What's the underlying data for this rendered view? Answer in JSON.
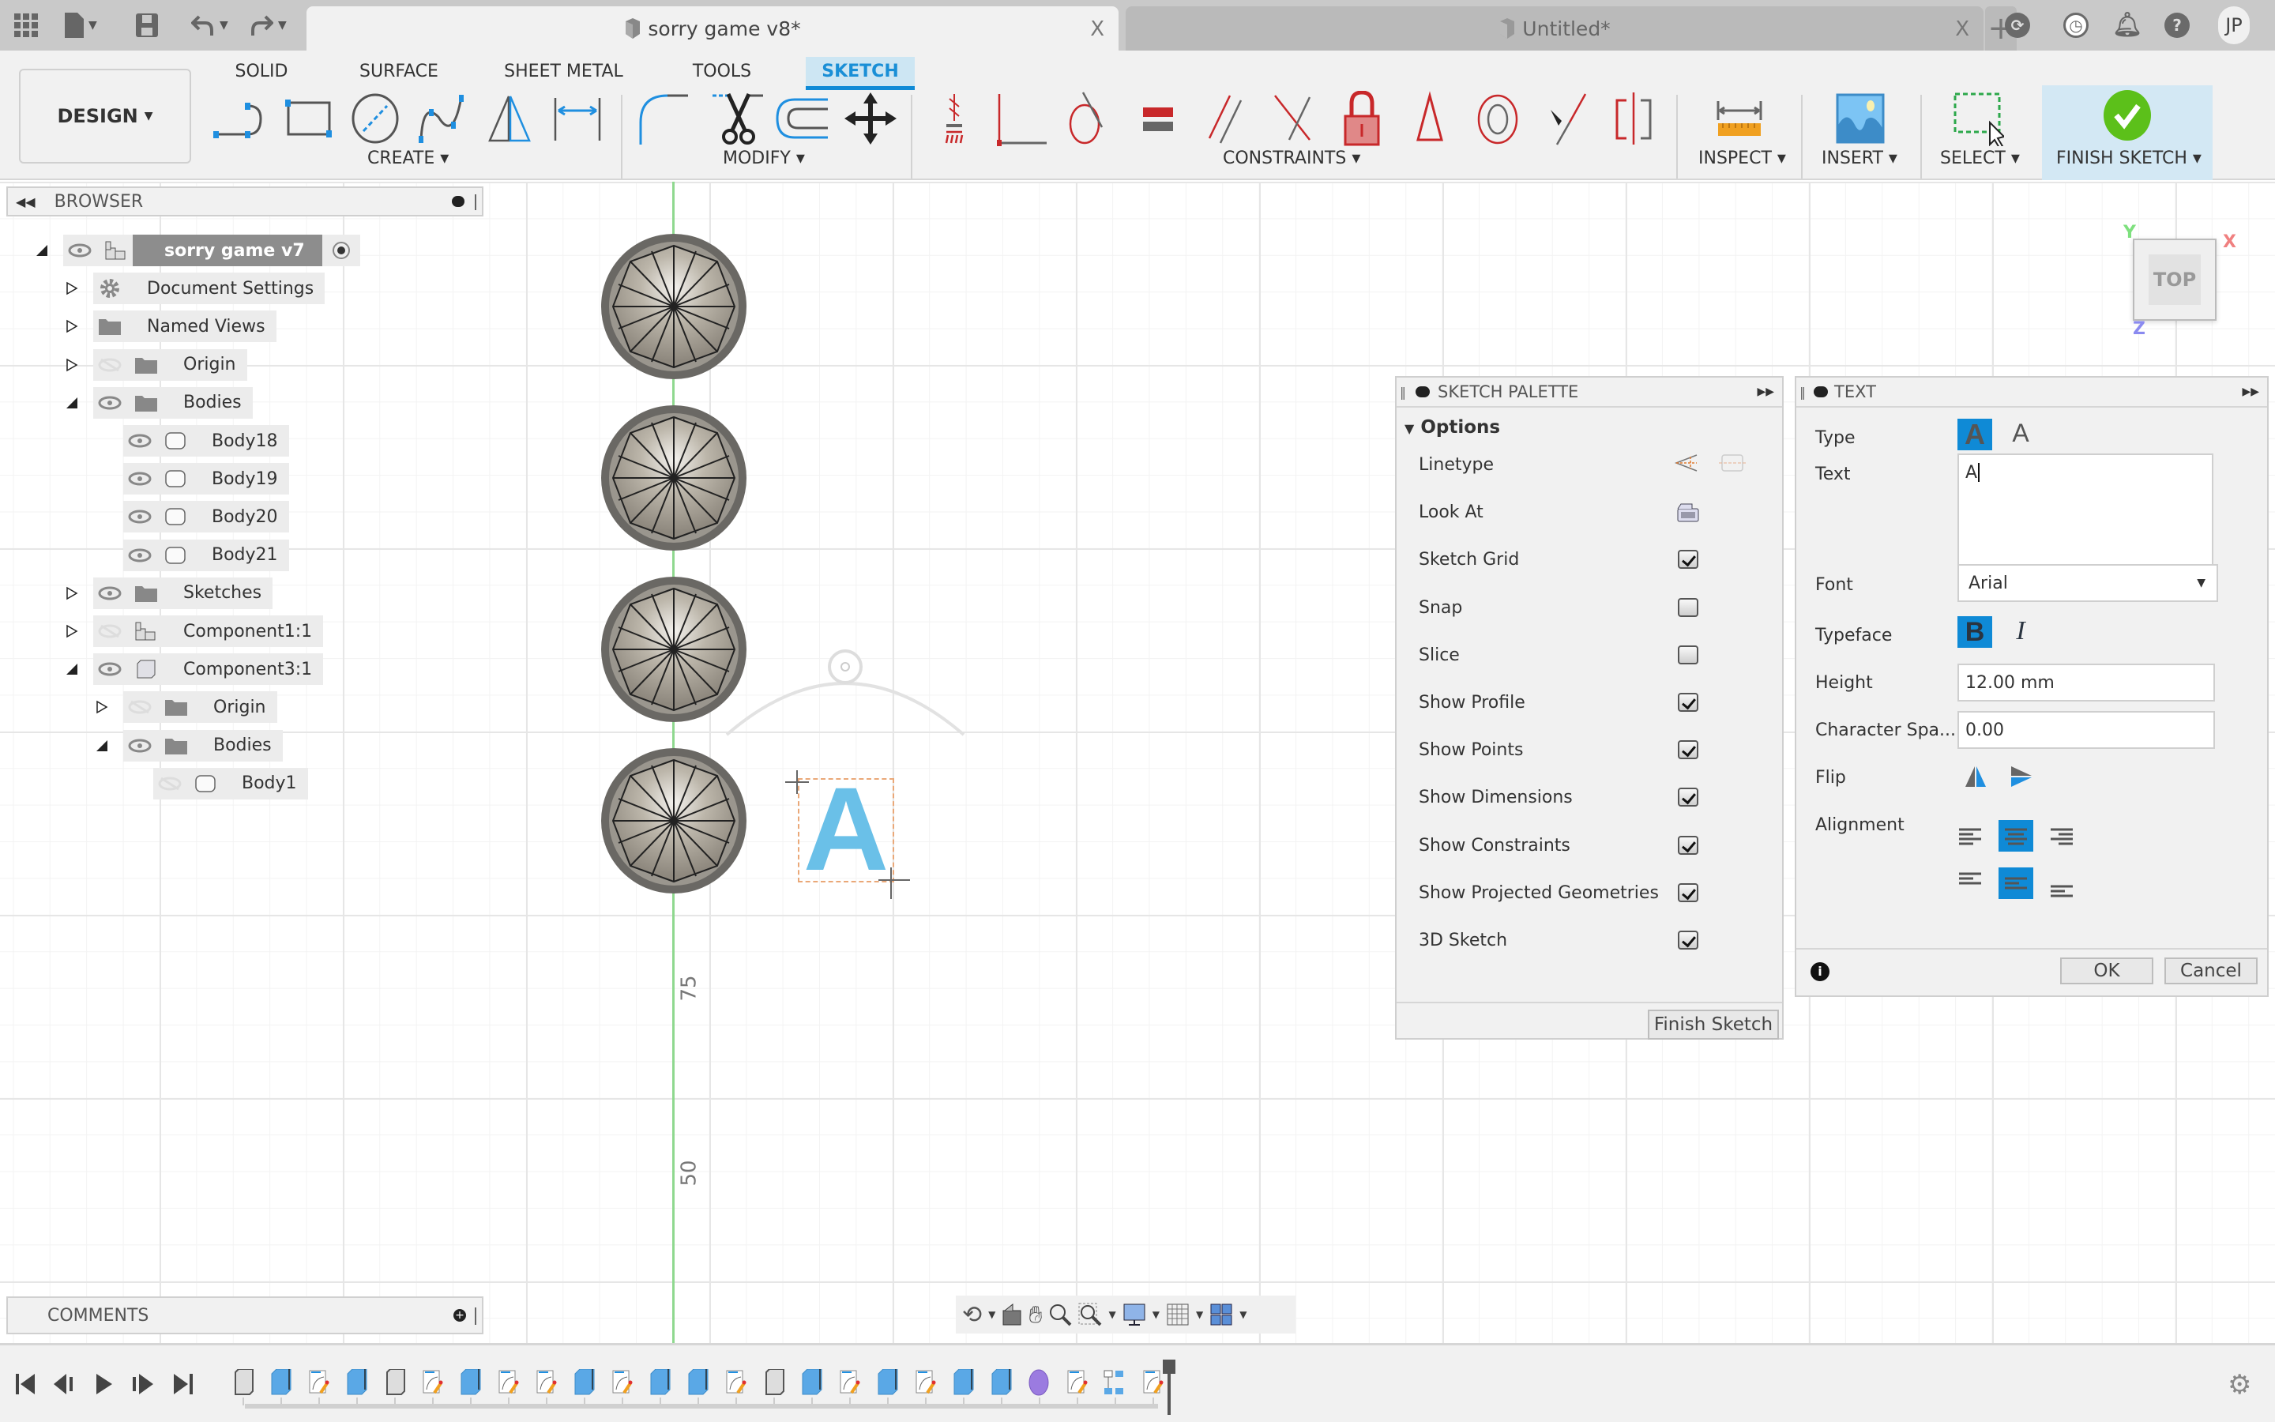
{
  "app": {
    "tabs": [
      {
        "title": "sorry game v8*",
        "active": true
      },
      {
        "title": "Untitled*",
        "active": false
      }
    ],
    "user_initials": "JP"
  },
  "ribbon": {
    "workspace": "DESIGN",
    "tabs": [
      "SOLID",
      "SURFACE",
      "SHEET METAL",
      "TOOLS",
      "SKETCH"
    ],
    "active_tab": "SKETCH",
    "groups": {
      "create": "CREATE",
      "modify": "MODIFY",
      "constraints": "CONSTRAINTS",
      "inspect": "INSPECT",
      "insert": "INSERT",
      "select": "SELECT",
      "finish": "FINISH SKETCH"
    },
    "create_tools": [
      "line-icon",
      "rectangle-icon",
      "circle-icon",
      "spline-icon",
      "mirror-icon",
      "dimension-icon"
    ],
    "modify_tools": [
      "fillet-icon",
      "trim-icon",
      "offset-icon",
      "move-icon"
    ],
    "constraint_tools": [
      "horizontal-vertical-icon",
      "coincident-icon",
      "tangent-icon",
      "equal-icon",
      "parallel-icon",
      "perpendicular-icon",
      "fix-icon",
      "midpoint-icon",
      "concentric-icon",
      "collinear-icon",
      "symmetry-icon"
    ]
  },
  "browser": {
    "title": "BROWSER",
    "items": [
      {
        "label": "sorry game v7",
        "depth": 0,
        "expanded": true,
        "visible": true,
        "icon": "component-icon",
        "root": true
      },
      {
        "label": "Document Settings",
        "depth": 1,
        "expanded": false,
        "icon": "gear-icon"
      },
      {
        "label": "Named Views",
        "depth": 1,
        "expanded": false,
        "icon": "folder-icon"
      },
      {
        "label": "Origin",
        "depth": 1,
        "expanded": false,
        "visible": false,
        "icon": "folder-icon"
      },
      {
        "label": "Bodies",
        "depth": 1,
        "expanded": true,
        "visible": true,
        "icon": "folder-icon"
      },
      {
        "label": "Body18",
        "depth": 2,
        "visible": true,
        "icon": "body-icon"
      },
      {
        "label": "Body19",
        "depth": 2,
        "visible": true,
        "icon": "body-icon"
      },
      {
        "label": "Body20",
        "depth": 2,
        "visible": true,
        "icon": "body-icon"
      },
      {
        "label": "Body21",
        "depth": 2,
        "visible": true,
        "icon": "body-icon"
      },
      {
        "label": "Sketches",
        "depth": 1,
        "expanded": false,
        "visible": true,
        "icon": "folder-icon"
      },
      {
        "label": "Component1:1",
        "depth": 1,
        "expanded": false,
        "visible": false,
        "icon": "component-icon"
      },
      {
        "label": "Component3:1",
        "depth": 1,
        "expanded": true,
        "visible": true,
        "icon": "component-box-icon"
      },
      {
        "label": "Origin",
        "depth": 2,
        "expanded": false,
        "visible": false,
        "icon": "folder-icon"
      },
      {
        "label": "Bodies",
        "depth": 2,
        "expanded": true,
        "visible": true,
        "icon": "folder-icon"
      },
      {
        "label": "Body1",
        "depth": 3,
        "visible": false,
        "icon": "body-icon"
      }
    ]
  },
  "viewcube": {
    "face": "TOP",
    "axes": [
      "X",
      "Y",
      "Z"
    ]
  },
  "viewport": {
    "axis_labels": [
      "75",
      "50"
    ],
    "sketch_text": "A"
  },
  "sketch_palette": {
    "title": "SKETCH PALETTE",
    "section": "Options",
    "rows": [
      {
        "label": "Linetype",
        "type": "icons"
      },
      {
        "label": "Look At",
        "type": "icon"
      },
      {
        "label": "Sketch Grid",
        "type": "checkbox",
        "checked": true
      },
      {
        "label": "Snap",
        "type": "checkbox",
        "checked": false
      },
      {
        "label": "Slice",
        "type": "checkbox",
        "checked": false
      },
      {
        "label": "Show Profile",
        "type": "checkbox",
        "checked": true
      },
      {
        "label": "Show Points",
        "type": "checkbox",
        "checked": true
      },
      {
        "label": "Show Dimensions",
        "type": "checkbox",
        "checked": true
      },
      {
        "label": "Show Constraints",
        "type": "checkbox",
        "checked": true
      },
      {
        "label": "Show Projected Geometries",
        "type": "checkbox",
        "checked": true
      },
      {
        "label": "3D Sketch",
        "type": "checkbox",
        "checked": true
      }
    ],
    "finish_button": "Finish Sketch"
  },
  "text_dialog": {
    "title": "TEXT",
    "labels": {
      "type": "Type",
      "text": "Text",
      "font": "Font",
      "typeface": "Typeface",
      "height": "Height",
      "spacing": "Character Spa...",
      "flip": "Flip",
      "alignment": "Alignment"
    },
    "text_value": "A",
    "font_value": "Arial",
    "height_value": "12.00 mm",
    "spacing_value": "0.00",
    "type_selected": "text",
    "bold": true,
    "italic": false,
    "horizontal_alignment": "center",
    "vertical_alignment": "middle",
    "ok": "OK",
    "cancel": "Cancel"
  },
  "comments": {
    "title": "COMMENTS"
  },
  "timeline": {
    "items": [
      "sketch-box",
      "extrude",
      "sketch",
      "extrude",
      "sketch-box",
      "sketch",
      "extrude",
      "sketch",
      "sketch",
      "extrude",
      "sketch",
      "extrude",
      "extrude",
      "sketch",
      "sketch-box",
      "extrude",
      "sketch",
      "extrude",
      "sketch",
      "extrude",
      "extrude",
      "joint",
      "sketch",
      "rigid-group",
      "sketch"
    ]
  },
  "colors": {
    "accent": "#0f8ad6",
    "sketch_text": "#6ac0e8",
    "constraint_red": "#c8282a",
    "finish_green": "#5cc01a"
  }
}
